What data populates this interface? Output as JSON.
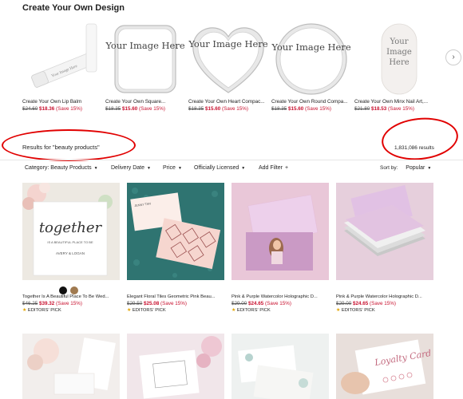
{
  "section_title": "Create Your Own Design",
  "carousel": [
    {
      "name": "Create Your Own Lip Balm",
      "old": "$24.60",
      "sale": "$18.36",
      "save": "(Save 15%)",
      "image_text": "Your Image Here"
    },
    {
      "name": "Create Your Own Square...",
      "old": "$18.35",
      "sale": "$15.60",
      "save": "(Save 15%)",
      "image_text": "Your Image Here"
    },
    {
      "name": "Create Your Own Heart Compac...",
      "old": "$18.35",
      "sale": "$15.60",
      "save": "(Save 15%)",
      "image_text": "Your Image Here"
    },
    {
      "name": "Create Your Own Round Compa...",
      "old": "$18.35",
      "sale": "$15.60",
      "save": "(Save 15%)",
      "image_text": "Your Image Here"
    },
    {
      "name": "Create Your Own Minx Nail Art,...",
      "old": "$21.80",
      "sale": "$18.53",
      "save": "(Save 15%)",
      "image_text": "Your Image Here"
    }
  ],
  "next_arrow": "›",
  "results": {
    "query_label": "Results for \"beauty products\"",
    "count": "1,831,086 results"
  },
  "filters": {
    "items": [
      "Category: Beauty Products",
      "Delivery Date",
      "Price",
      "Officially Licensed",
      "Add Filter"
    ],
    "sort_label": "Sort by:",
    "sort_value": "Popular"
  },
  "products": [
    {
      "name": "Together Is A Beautiful Place To Be Wed...",
      "old": "$46.25",
      "sale": "$39.32",
      "save": "(Save 15%)",
      "badge": "EDITORS' PICK",
      "swatches": [
        "#111111",
        "#a07a50"
      ]
    },
    {
      "name": "Elegant Floral Tiles Geometric Pink Beau...",
      "old": "$29.50",
      "sale": "$25.08",
      "save": "(Save 15%)",
      "badge": "EDITORS' PICK"
    },
    {
      "name": "Pink & Purple Watercolor Holographic D...",
      "old": "$29.00",
      "sale": "$24.65",
      "save": "(Save 15%)",
      "badge": "EDITORS' PICK"
    },
    {
      "name": "Pink & Purple Watercolor Holographic D...",
      "old": "$29.00",
      "sale": "$24.65",
      "save": "(Save 15%)",
      "badge": "EDITORS' PICK"
    }
  ],
  "product_image_text": {
    "together_big": "together",
    "together_sub": "IS A BEAUTIFUL PLACE TO BE",
    "together_names": "AVERY & LOGAN",
    "loyalty": "Loyalty Card"
  },
  "colors": {
    "sale": "#c8102e",
    "annotation": "#e10000",
    "star": "#e2a400"
  }
}
